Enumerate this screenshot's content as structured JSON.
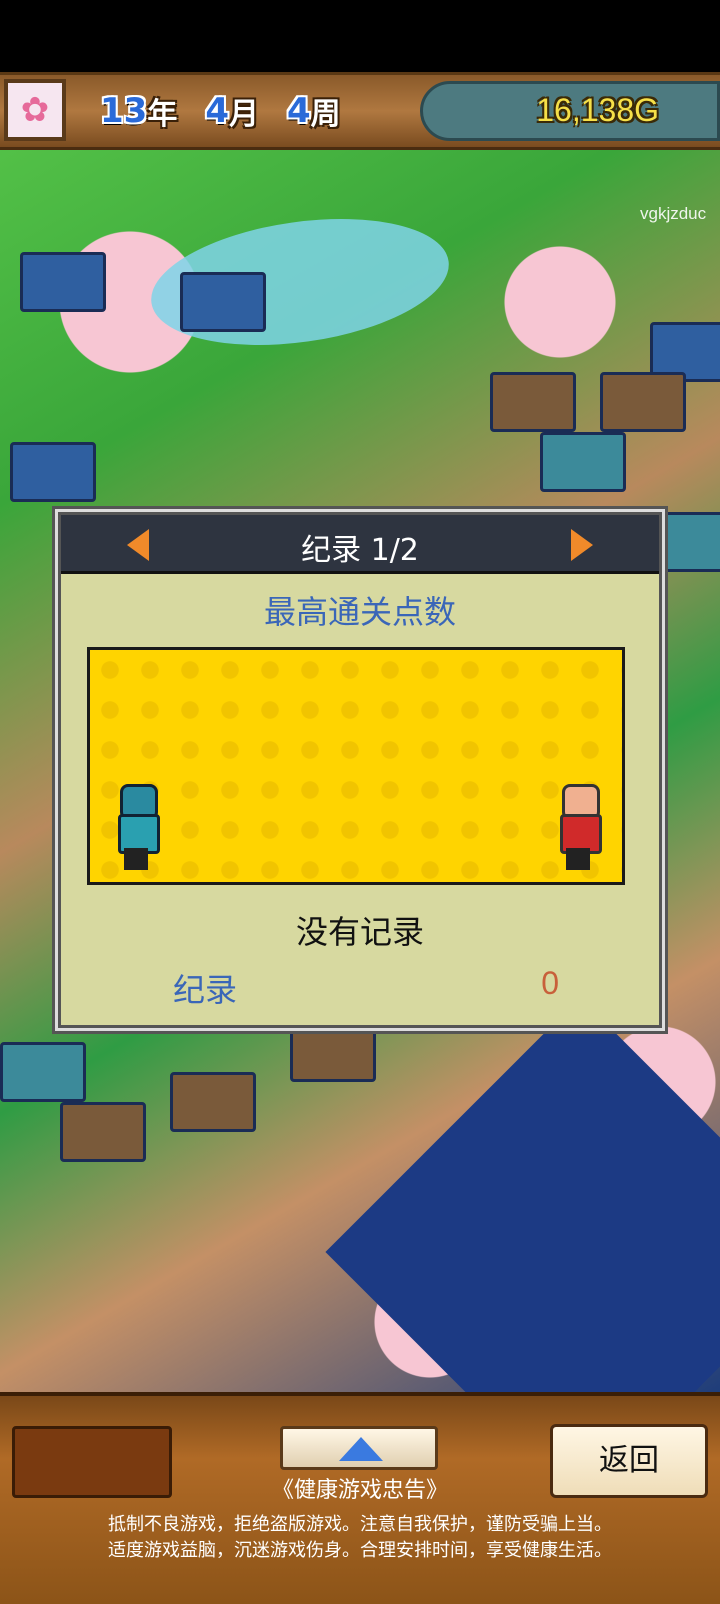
{
  "header": {
    "year_num": "13",
    "year_unit": "年",
    "month_num": "4",
    "month_unit": "月",
    "week_num": "4",
    "week_unit": "周",
    "gold": "16,138G",
    "avatar_icon": "sakura-icon"
  },
  "watermark": "vgkjzduc",
  "dialog": {
    "title": "纪录 1/2",
    "subtitle": "最高通关点数",
    "empty_text": "没有记录",
    "record_label": "纪录",
    "record_value": "0"
  },
  "bottom": {
    "back_label": "返回",
    "notice_title": "《健康游戏忠告》",
    "notice_line1": "抵制不良游戏，拒绝盗版游戏。注意自我保护，谨防受骗上当。",
    "notice_line2": "适度游戏益脑，沉迷游戏伤身。合理安排时间，享受健康生活。"
  },
  "colors": {
    "accent_arrow": "#f08a2a",
    "gold_text": "#f6e048",
    "label_blue": "#3a66b8",
    "value_orange": "#c8603a"
  }
}
